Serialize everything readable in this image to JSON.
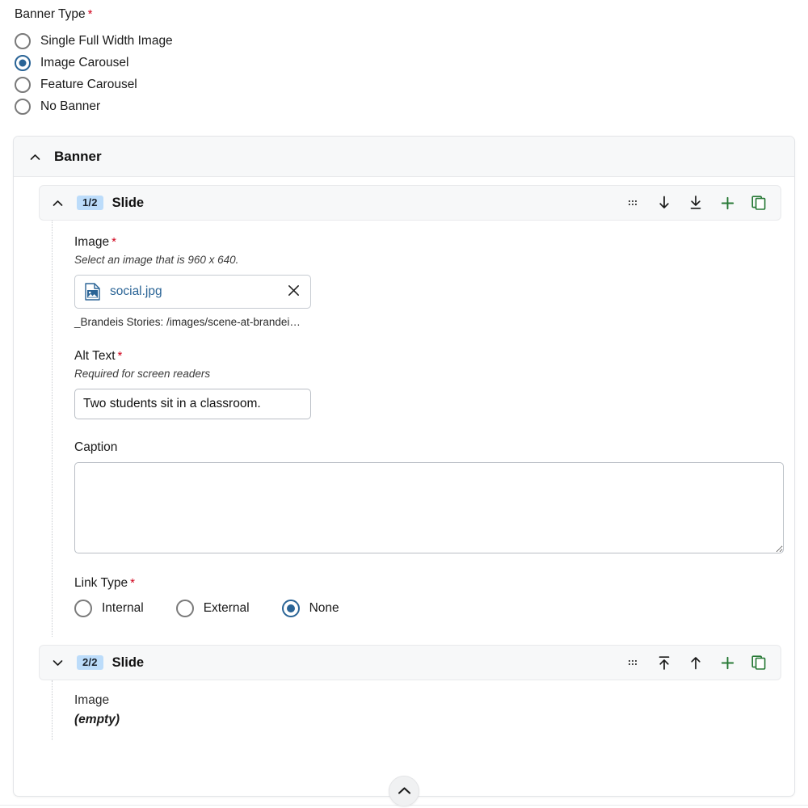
{
  "banner_type": {
    "label": "Banner Type",
    "required_marker": "*",
    "options": [
      {
        "label": "Single Full Width Image",
        "selected": false
      },
      {
        "label": "Image Carousel",
        "selected": true
      },
      {
        "label": "Feature Carousel",
        "selected": false
      },
      {
        "label": "No Banner",
        "selected": false
      }
    ]
  },
  "banner_panel": {
    "title": "Banner",
    "collapse_icon": "chevron-up-icon",
    "collapsed": false
  },
  "slide1": {
    "badge": "1/2",
    "title": "Slide",
    "collapse_icon": "chevron-up-icon",
    "tools": [
      {
        "name": "drag-handle-icon",
        "label": ""
      },
      {
        "name": "move-down-icon",
        "label": "↓"
      },
      {
        "name": "move-to-bottom-icon",
        "label": "↓"
      },
      {
        "name": "add-icon",
        "label": "+"
      },
      {
        "name": "duplicate-icon",
        "label": ""
      }
    ],
    "image": {
      "label": "Image",
      "required_marker": "*",
      "description": "Select an image that is 960 x 640.",
      "file_icon": "image-file-icon",
      "file_name": "social.jpg",
      "remove_label": "✕",
      "path": "_Brandeis Stories: /images/scene-at-brandei…"
    },
    "alt_text": {
      "label": "Alt Text",
      "required_marker": "*",
      "description": "Required for screen readers",
      "value": "Two students sit in a classroom.",
      "placeholder": ""
    },
    "caption": {
      "label": "Caption",
      "value": "",
      "placeholder": ""
    },
    "link_type": {
      "label": "Link Type",
      "required_marker": "*",
      "options": [
        {
          "label": "Internal",
          "selected": false
        },
        {
          "label": "External",
          "selected": false
        },
        {
          "label": "None",
          "selected": true
        }
      ]
    }
  },
  "slide2": {
    "badge": "2/2",
    "title": "Slide",
    "collapse_icon": "chevron-down-icon",
    "tools": [
      {
        "name": "drag-handle-icon",
        "label": ""
      },
      {
        "name": "move-to-top-icon",
        "label": "↑"
      },
      {
        "name": "move-up-icon",
        "label": "↑"
      },
      {
        "name": "add-icon",
        "label": "+"
      },
      {
        "name": "duplicate-icon",
        "label": ""
      }
    ],
    "summary": {
      "label": "Image",
      "value": "(empty)"
    }
  },
  "footer": {
    "collapse_all_icon": "chevron-up-icon"
  },
  "colors": {
    "accent_blue": "#2a6496",
    "required_red": "#d0021b",
    "badge_blue": "#bcdcfa",
    "tool_green": "#287a37",
    "panel_gray": "#f7f8f9",
    "border_gray": "#e3e5e8"
  }
}
